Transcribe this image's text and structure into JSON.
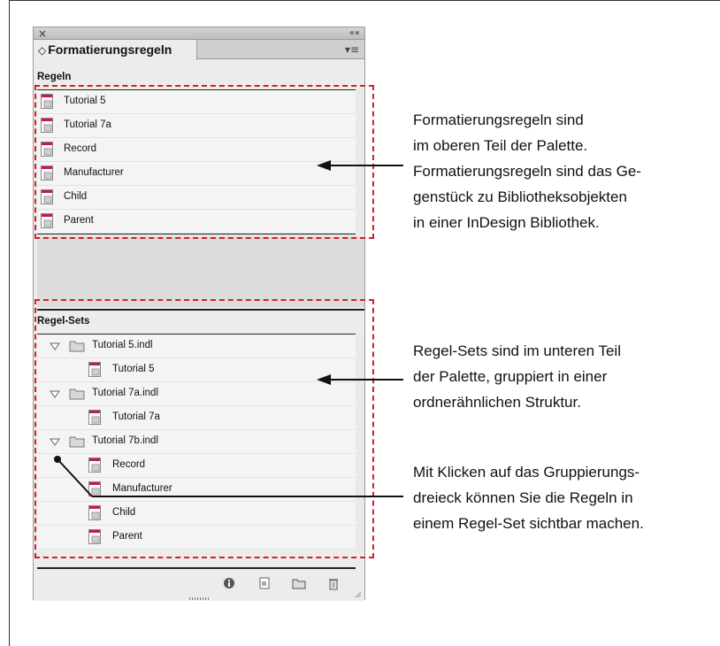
{
  "palette": {
    "close_glyph": "×",
    "collapse_glyph": "««",
    "tab_title": "Formatierungsregeln",
    "tab_updown_glyph": "◇",
    "menu_glyph": "▾≡"
  },
  "regeln": {
    "label": "Regeln",
    "items": [
      {
        "label": "Tutorial 5",
        "icon": "rule-doc-icon"
      },
      {
        "label": "Tutorial 7a",
        "icon": "rule-doc-icon"
      },
      {
        "label": "Record",
        "icon": "rule-doc-icon"
      },
      {
        "label": "Manufacturer",
        "icon": "rule-doc-icon"
      },
      {
        "label": "Child",
        "icon": "rule-doc-icon"
      },
      {
        "label": "Parent",
        "icon": "rule-doc-icon"
      }
    ]
  },
  "regel_sets": {
    "label": "Regel-Sets",
    "items": [
      {
        "label": "Tutorial 5.indl",
        "type": "folder",
        "expanded": true
      },
      {
        "label": "Tutorial 5",
        "type": "rule"
      },
      {
        "label": "Tutorial 7a.indl",
        "type": "folder",
        "expanded": true
      },
      {
        "label": "Tutorial 7a",
        "type": "rule"
      },
      {
        "label": "Tutorial 7b.indl",
        "type": "folder",
        "expanded": true
      },
      {
        "label": "Record",
        "type": "rule"
      },
      {
        "label": "Manufacturer",
        "type": "rule"
      },
      {
        "label": "Child",
        "type": "rule"
      },
      {
        "label": "Parent",
        "type": "rule"
      }
    ]
  },
  "bottom_toolbar": {
    "icons": [
      "info-icon",
      "new-rule-icon",
      "new-folder-icon",
      "trash-icon"
    ]
  },
  "annotations": {
    "a1": [
      "Formatierungsregeln sind",
      "im oberen Teil der Palette.",
      "Formatierungsregeln sind das Ge-",
      "genstück zu Bibliotheksobjekten",
      "in einer InDesign Bibliothek."
    ],
    "a2": [
      "Regel-Sets sind im unteren Teil",
      "der Palette, gruppiert in einer",
      "ordnerähnlichen Struktur."
    ],
    "a3": [
      "Mit Klicken auf das Gruppierungs-",
      "dreieck können Sie die Regeln in",
      "einem Regel-Set sichtbar machen."
    ]
  },
  "colors": {
    "highlight_dash": "#d4202a",
    "rule_icon_accent": "#c2185b",
    "folder_fill": "#d8d8d8"
  }
}
